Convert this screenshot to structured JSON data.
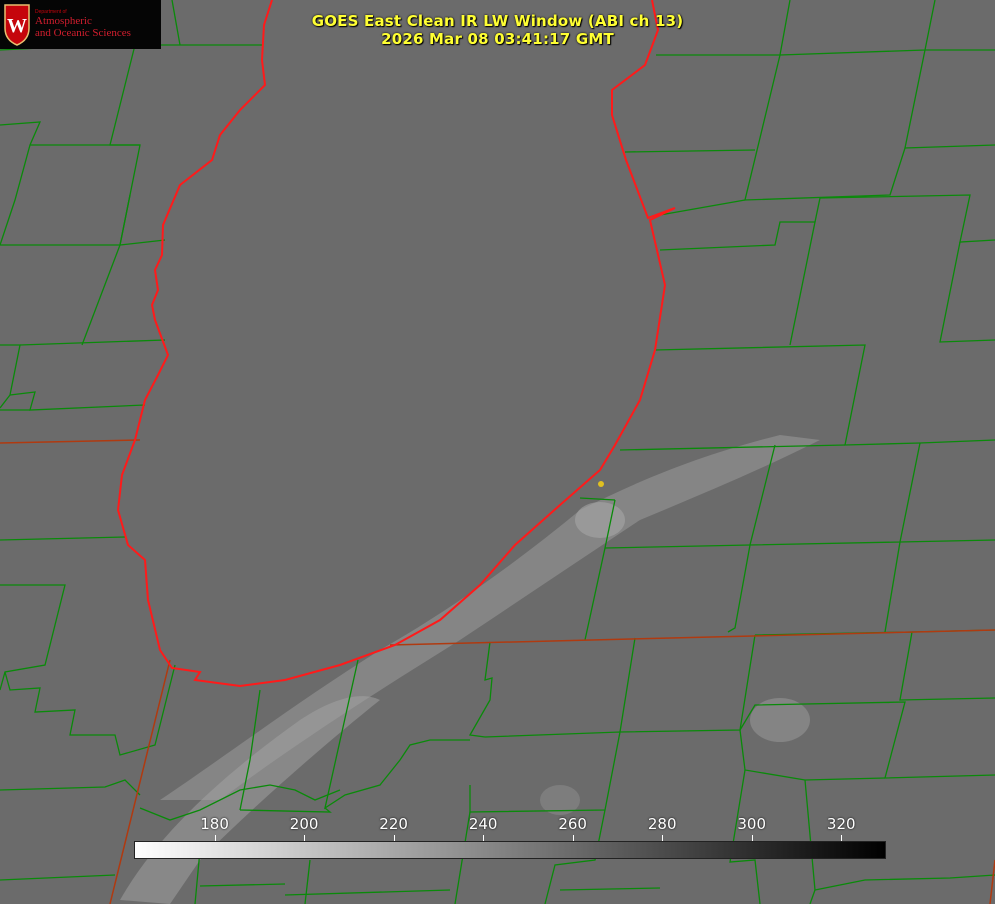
{
  "title": {
    "line1": "GOES East Clean IR LW Window (ABI ch 13)",
    "line2": "2026 Mar 08 03:41:17 GMT"
  },
  "logo": {
    "department": "Department of",
    "org_line1": "Atmospheric",
    "org_line2": "and Oceanic Sciences",
    "crest_letter": "W",
    "crest_color": "#c5050c"
  },
  "colorbar": {
    "ticks": [
      "180",
      "200",
      "220",
      "240",
      "260",
      "280",
      "300",
      "320"
    ],
    "tick_values": [
      180,
      200,
      220,
      240,
      260,
      280,
      300,
      320
    ],
    "range": [
      162,
      330
    ],
    "low_color": "#ffffff",
    "high_color": "#000000"
  },
  "colors": {
    "background_gray": "#6a6a6a",
    "county_lines": "#0a8a0a",
    "coastline": "#ff1a1a",
    "state_line": "#b03a10",
    "title_text": "#ffff33",
    "marker": "#e0c020"
  }
}
